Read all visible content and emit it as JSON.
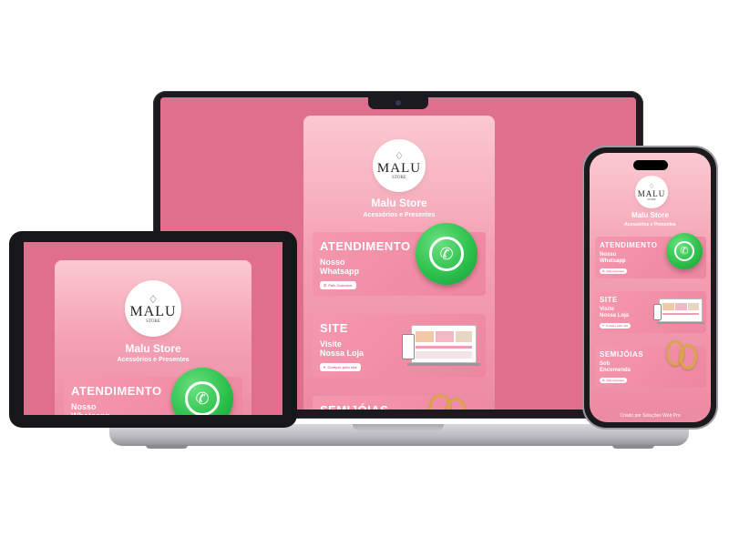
{
  "store": {
    "name": "Malu Store",
    "subtitle": "Acessórios e Presentes",
    "logo_text": "MALU",
    "logo_sub": "STORE"
  },
  "links": [
    {
      "title": "ATENDIMENTO",
      "text_line1": "Nosso",
      "text_line2": "Whatsapp",
      "button": "Fale Conosco",
      "icon": "whatsapp-icon"
    },
    {
      "title": "SITE",
      "text_line1": "Visite",
      "text_line2": "Nossa Loja",
      "button": "Compre pelo site",
      "icon": "devices-icon"
    },
    {
      "title": "SEMIJÓIAS",
      "text_line1": "Sob",
      "text_line2": "Encomenda",
      "button": "Fale Conosco",
      "icon": "rings-icon"
    }
  ],
  "footer": {
    "credit": "Criado por Soluções Web Pro"
  },
  "icons": {
    "diamond": "diamond-icon",
    "phone": "phone-icon"
  },
  "colors": {
    "screen_bg": "#df6f8d",
    "card_top": "#fbc9d0",
    "card_bottom": "#ec8aa3",
    "whatsapp": "#2dc24d",
    "gold": "#d9a54a"
  }
}
